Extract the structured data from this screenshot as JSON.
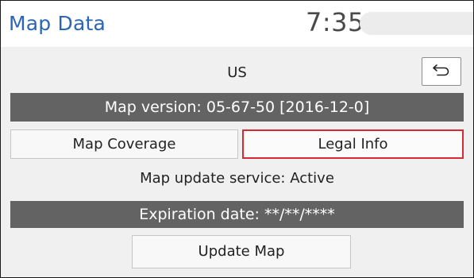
{
  "header": {
    "title": "Map Data",
    "clock": "7:35"
  },
  "region": {
    "label": "US"
  },
  "map_version": {
    "text": "Map version: 05-67-50   [2016-12-0]"
  },
  "actions": {
    "map_coverage_label": "Map Coverage",
    "legal_info_label": "Legal Info",
    "update_map_label": "Update Map"
  },
  "service": {
    "status_text": "Map update service: Active"
  },
  "expiration": {
    "text": "Expiration date: **/**/****"
  },
  "icons": {
    "back": "back-arrow-icon"
  },
  "colors": {
    "title_blue": "#2a66b3",
    "bar_gray": "#636363",
    "selected_outline_red": "#d82a32"
  }
}
